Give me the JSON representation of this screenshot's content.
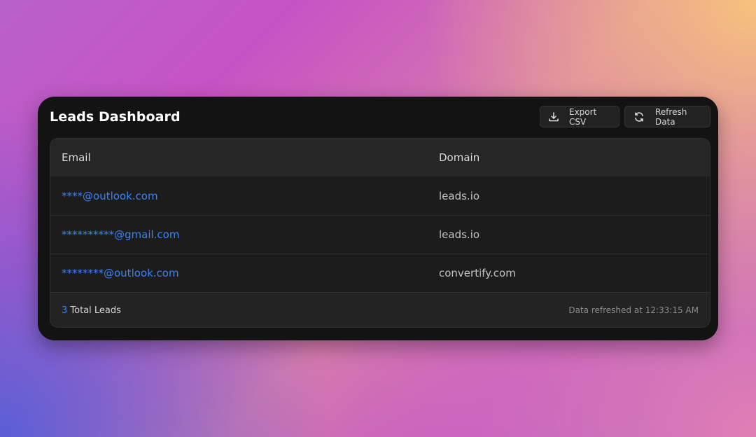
{
  "header": {
    "title": "Leads Dashboard",
    "export_label": "Export CSV",
    "export_icon": "download-icon",
    "refresh_label": "Refresh Data",
    "refresh_icon": "refresh-icon"
  },
  "table": {
    "columns": [
      "Email",
      "Domain"
    ],
    "rows": [
      {
        "email": "****@outlook.com",
        "domain": "leads.io"
      },
      {
        "email": "**********@gmail.com",
        "domain": "leads.io"
      },
      {
        "email": "********@outlook.com",
        "domain": "convertify.com"
      }
    ]
  },
  "footer": {
    "count": "3",
    "count_suffix": "Total Leads",
    "refreshed_text": "Data refreshed at 12:33:15 AM"
  },
  "colors": {
    "accent": "#3b82f6",
    "card_bg": "#131313"
  }
}
